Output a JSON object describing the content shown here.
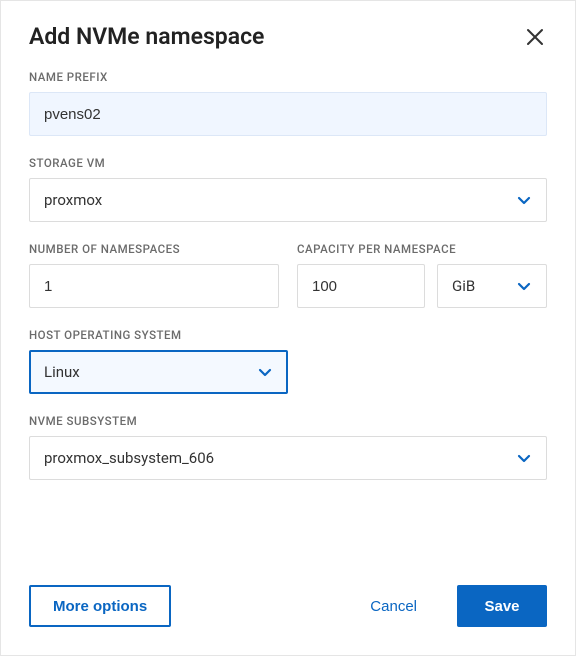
{
  "dialog": {
    "title": "Add NVMe namespace"
  },
  "fields": {
    "name_prefix": {
      "label": "NAME PREFIX",
      "value": "pvens02"
    },
    "storage_vm": {
      "label": "STORAGE VM",
      "value": "proxmox"
    },
    "num_namespaces": {
      "label": "NUMBER OF NAMESPACES",
      "value": "1"
    },
    "capacity": {
      "label": "CAPACITY PER NAMESPACE",
      "value": "100",
      "unit": "GiB"
    },
    "host_os": {
      "label": "HOST OPERATING SYSTEM",
      "value": "Linux"
    },
    "nvme_subsystem": {
      "label": "NVME SUBSYSTEM",
      "value": "proxmox_subsystem_606"
    }
  },
  "buttons": {
    "more_options": "More options",
    "cancel": "Cancel",
    "save": "Save"
  }
}
